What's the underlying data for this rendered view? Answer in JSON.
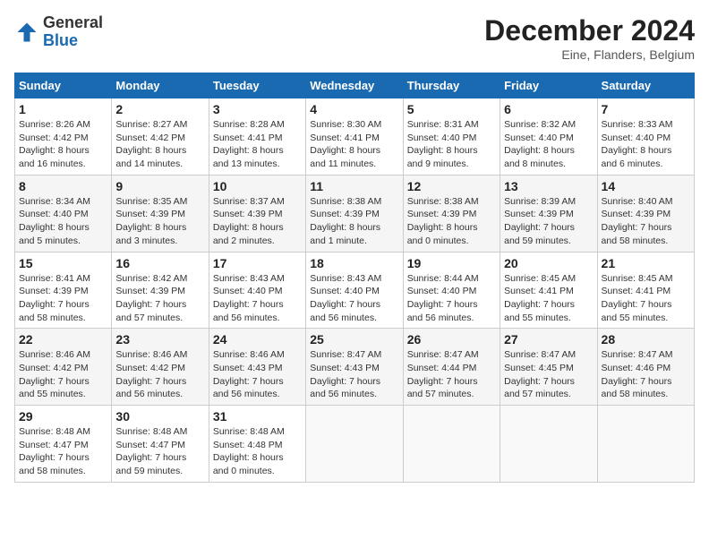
{
  "header": {
    "logo_line1": "General",
    "logo_line2": "Blue",
    "title": "December 2024",
    "subtitle": "Eine, Flanders, Belgium"
  },
  "days_of_week": [
    "Sunday",
    "Monday",
    "Tuesday",
    "Wednesday",
    "Thursday",
    "Friday",
    "Saturday"
  ],
  "weeks": [
    [
      {
        "day": "1",
        "info": "Sunrise: 8:26 AM\nSunset: 4:42 PM\nDaylight: 8 hours\nand 16 minutes."
      },
      {
        "day": "2",
        "info": "Sunrise: 8:27 AM\nSunset: 4:42 PM\nDaylight: 8 hours\nand 14 minutes."
      },
      {
        "day": "3",
        "info": "Sunrise: 8:28 AM\nSunset: 4:41 PM\nDaylight: 8 hours\nand 13 minutes."
      },
      {
        "day": "4",
        "info": "Sunrise: 8:30 AM\nSunset: 4:41 PM\nDaylight: 8 hours\nand 11 minutes."
      },
      {
        "day": "5",
        "info": "Sunrise: 8:31 AM\nSunset: 4:40 PM\nDaylight: 8 hours\nand 9 minutes."
      },
      {
        "day": "6",
        "info": "Sunrise: 8:32 AM\nSunset: 4:40 PM\nDaylight: 8 hours\nand 8 minutes."
      },
      {
        "day": "7",
        "info": "Sunrise: 8:33 AM\nSunset: 4:40 PM\nDaylight: 8 hours\nand 6 minutes."
      }
    ],
    [
      {
        "day": "8",
        "info": "Sunrise: 8:34 AM\nSunset: 4:40 PM\nDaylight: 8 hours\nand 5 minutes."
      },
      {
        "day": "9",
        "info": "Sunrise: 8:35 AM\nSunset: 4:39 PM\nDaylight: 8 hours\nand 3 minutes."
      },
      {
        "day": "10",
        "info": "Sunrise: 8:37 AM\nSunset: 4:39 PM\nDaylight: 8 hours\nand 2 minutes."
      },
      {
        "day": "11",
        "info": "Sunrise: 8:38 AM\nSunset: 4:39 PM\nDaylight: 8 hours\nand 1 minute."
      },
      {
        "day": "12",
        "info": "Sunrise: 8:38 AM\nSunset: 4:39 PM\nDaylight: 8 hours\nand 0 minutes."
      },
      {
        "day": "13",
        "info": "Sunrise: 8:39 AM\nSunset: 4:39 PM\nDaylight: 7 hours\nand 59 minutes."
      },
      {
        "day": "14",
        "info": "Sunrise: 8:40 AM\nSunset: 4:39 PM\nDaylight: 7 hours\nand 58 minutes."
      }
    ],
    [
      {
        "day": "15",
        "info": "Sunrise: 8:41 AM\nSunset: 4:39 PM\nDaylight: 7 hours\nand 58 minutes."
      },
      {
        "day": "16",
        "info": "Sunrise: 8:42 AM\nSunset: 4:39 PM\nDaylight: 7 hours\nand 57 minutes."
      },
      {
        "day": "17",
        "info": "Sunrise: 8:43 AM\nSunset: 4:40 PM\nDaylight: 7 hours\nand 56 minutes."
      },
      {
        "day": "18",
        "info": "Sunrise: 8:43 AM\nSunset: 4:40 PM\nDaylight: 7 hours\nand 56 minutes."
      },
      {
        "day": "19",
        "info": "Sunrise: 8:44 AM\nSunset: 4:40 PM\nDaylight: 7 hours\nand 56 minutes."
      },
      {
        "day": "20",
        "info": "Sunrise: 8:45 AM\nSunset: 4:41 PM\nDaylight: 7 hours\nand 55 minutes."
      },
      {
        "day": "21",
        "info": "Sunrise: 8:45 AM\nSunset: 4:41 PM\nDaylight: 7 hours\nand 55 minutes."
      }
    ],
    [
      {
        "day": "22",
        "info": "Sunrise: 8:46 AM\nSunset: 4:42 PM\nDaylight: 7 hours\nand 55 minutes."
      },
      {
        "day": "23",
        "info": "Sunrise: 8:46 AM\nSunset: 4:42 PM\nDaylight: 7 hours\nand 56 minutes."
      },
      {
        "day": "24",
        "info": "Sunrise: 8:46 AM\nSunset: 4:43 PM\nDaylight: 7 hours\nand 56 minutes."
      },
      {
        "day": "25",
        "info": "Sunrise: 8:47 AM\nSunset: 4:43 PM\nDaylight: 7 hours\nand 56 minutes."
      },
      {
        "day": "26",
        "info": "Sunrise: 8:47 AM\nSunset: 4:44 PM\nDaylight: 7 hours\nand 57 minutes."
      },
      {
        "day": "27",
        "info": "Sunrise: 8:47 AM\nSunset: 4:45 PM\nDaylight: 7 hours\nand 57 minutes."
      },
      {
        "day": "28",
        "info": "Sunrise: 8:47 AM\nSunset: 4:46 PM\nDaylight: 7 hours\nand 58 minutes."
      }
    ],
    [
      {
        "day": "29",
        "info": "Sunrise: 8:48 AM\nSunset: 4:47 PM\nDaylight: 7 hours\nand 58 minutes."
      },
      {
        "day": "30",
        "info": "Sunrise: 8:48 AM\nSunset: 4:47 PM\nDaylight: 7 hours\nand 59 minutes."
      },
      {
        "day": "31",
        "info": "Sunrise: 8:48 AM\nSunset: 4:48 PM\nDaylight: 8 hours\nand 0 minutes."
      },
      {
        "day": "",
        "info": ""
      },
      {
        "day": "",
        "info": ""
      },
      {
        "day": "",
        "info": ""
      },
      {
        "day": "",
        "info": ""
      }
    ]
  ]
}
